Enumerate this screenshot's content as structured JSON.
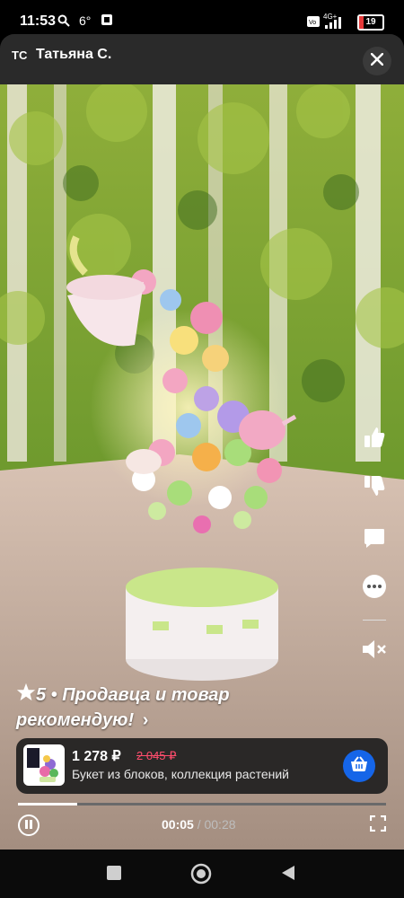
{
  "status_bar": {
    "time": "11:53",
    "temperature": "6°",
    "battery": "19",
    "network": "4G+"
  },
  "header": {
    "avatar_initials": "ТС",
    "author": "Татьяна С."
  },
  "review": {
    "rating": "5",
    "text": " • Продавца и товар рекомендую!",
    "arrow": "›"
  },
  "product": {
    "price": "1 278 ₽",
    "old_price": "2 045 ₽",
    "name": "Букет из блоков, коллекция растений"
  },
  "player": {
    "current_time": "00:05",
    "separator": "/",
    "duration": "00:28",
    "progress": 0.16
  },
  "colors": {
    "accent": "#1565e8",
    "old_price": "#ff4d6d",
    "battery_low": "#e63a3a"
  }
}
